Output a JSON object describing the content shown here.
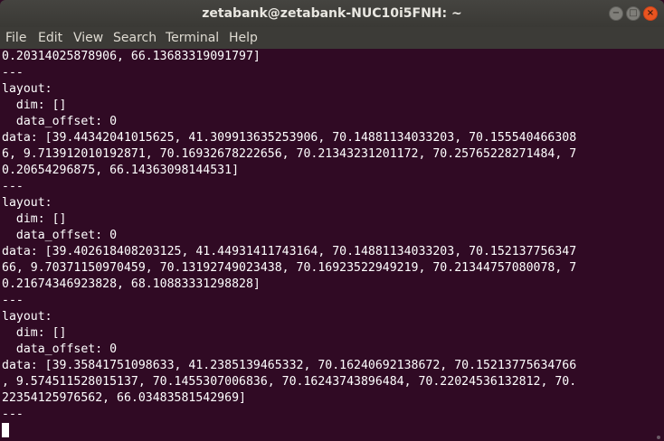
{
  "window": {
    "title": "zetabank@zetabank-NUC10i5FNH: ~",
    "minimize_glyph": "−",
    "maximize_glyph": "□",
    "close_glyph": "×",
    "icons": [
      "minimize-icon",
      "maximize-icon",
      "close-icon"
    ]
  },
  "menubar": {
    "items": [
      {
        "label": "File"
      },
      {
        "label": "Edit"
      },
      {
        "label": "View"
      },
      {
        "label": "Search"
      },
      {
        "label": "Terminal"
      },
      {
        "label": "Help"
      }
    ]
  },
  "terminal": {
    "lines": [
      "0.20314025878906, 66.13683319091797]",
      "---",
      "layout:",
      "  dim: []",
      "  data_offset: 0",
      "data: [39.44342041015625, 41.309913635253906, 70.1488113403320З, 70.155540466308",
      "6, 9.713912010192871, 70.16932678222656, 70.21343231201172, 70.25765228271484, 7",
      "0.20654296875, 66.14363098144531]",
      "---",
      "layout:",
      "  dim: []",
      "  data_offset: 0",
      "data: [39.402618408203125, 41.44931411743164, 70.14881134033203, 70.152137756347",
      "66, 9.70371150970459, 70.13192749023438, 70.16923522949219, 70.21344757080078, 7",
      "0.21674346923828, 68.10883331298828]",
      "---",
      "layout:",
      "  dim: []",
      "  data_offset: 0",
      "data: [39.35841751098633, 41.2385139465332, 70.16240692138672, 70.15213775634766",
      ", 9.574511528015137, 70.1455307006836, 70.16243743896484, 70.22024536132812, 70.",
      "22354125976562, 66.03483581542969]",
      "---"
    ]
  }
}
